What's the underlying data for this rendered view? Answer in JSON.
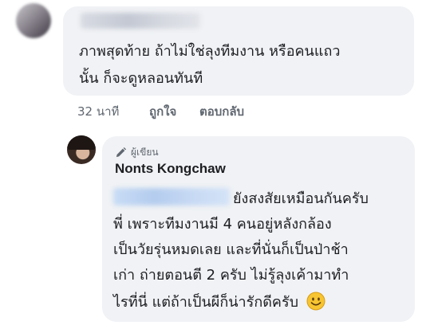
{
  "comment1": {
    "text": "ภาพสุดท้าย ถ้าไม่ใช่ลุงทีมงาน หรือคนแถว\nนั้น ก็จะดูหลอนทันที",
    "time": "32 นาที",
    "like_label": "ถูกใจ",
    "reply_label": "ตอบกลับ"
  },
  "reply": {
    "author_badge": "ผู้เขียน",
    "author_name": "Nonts Kongchaw",
    "lines": [
      "ยังสงสัยเหมือนกันครับ",
      "พี่ เพราะทีมงานมี 4 คนอยู่หลังกล้อง",
      "เป็นวัยรุ่นหมดเลย  และที่นั่นก็เป็นป่าช้า",
      "เก่า ถ่ายตอนตี 2 ครับ ไม่รู้ลุงเค้ามาทำ",
      "ไรที่นี่ แต่ถ้าเป็นผีก็น่ารักดีครับ"
    ]
  }
}
